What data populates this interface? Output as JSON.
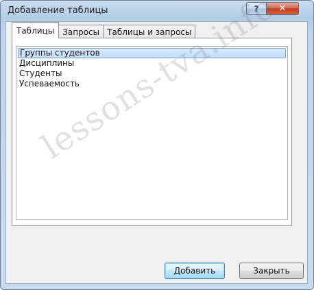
{
  "window": {
    "title": "Добавление таблицы",
    "help_glyph": "?",
    "close_glyph": "✕"
  },
  "tabs": [
    {
      "label": "Таблицы",
      "active": true
    },
    {
      "label": "Запросы",
      "active": false
    },
    {
      "label": "Таблицы и запросы",
      "active": false
    }
  ],
  "list": {
    "items": [
      {
        "label": "Группы студентов",
        "selected": true
      },
      {
        "label": "Дисциплины",
        "selected": false
      },
      {
        "label": "Студенты",
        "selected": false
      },
      {
        "label": "Успеваемость",
        "selected": false
      }
    ]
  },
  "buttons": {
    "add_label": "Добавить",
    "close_label": "Закрыть"
  },
  "watermark": "lessons-tva.info",
  "colors": {
    "selection": "#c1dcfb",
    "close_button": "#c43c1f",
    "frame": "#bfd5ec"
  }
}
